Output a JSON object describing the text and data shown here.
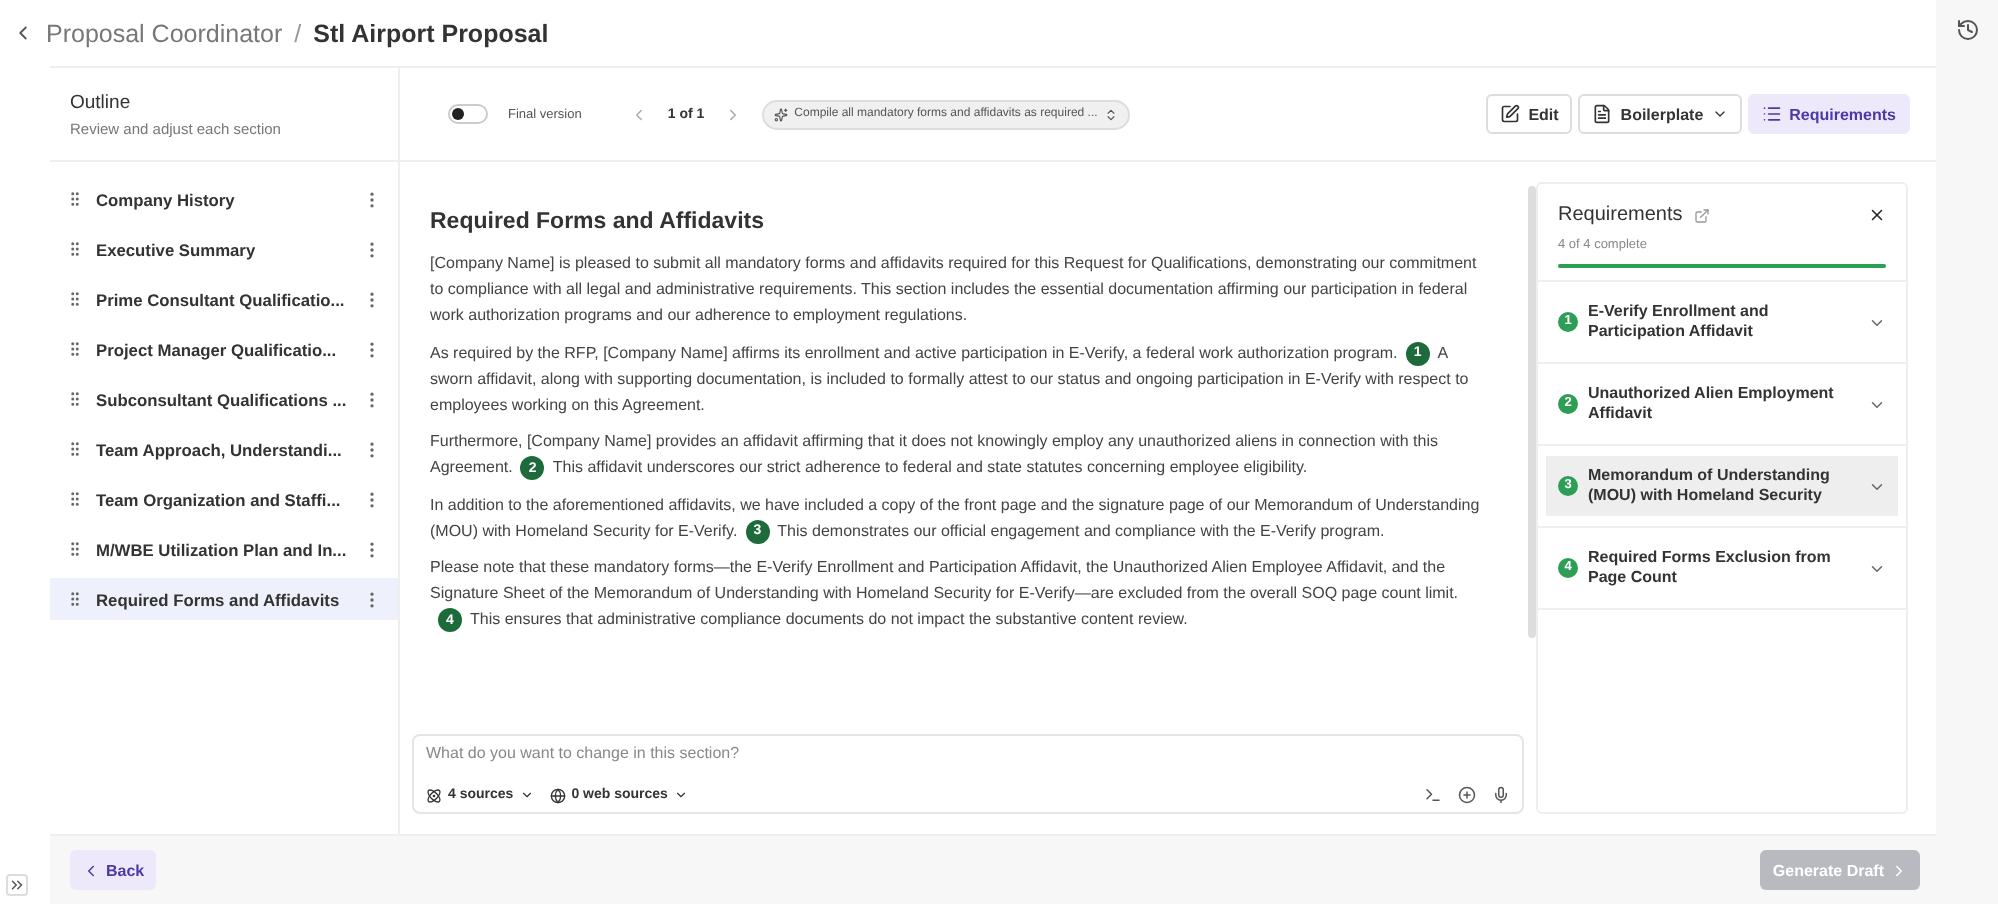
{
  "header": {
    "parent": "Proposal Coordinator",
    "separator": "/",
    "title": "Stl Airport Proposal"
  },
  "outline": {
    "title": "Outline",
    "subtitle": "Review and adjust each section",
    "items": [
      {
        "label": "Company History",
        "selected": false
      },
      {
        "label": "Executive Summary",
        "selected": false
      },
      {
        "label": "Prime Consultant Qualificatio...",
        "selected": false
      },
      {
        "label": "Project Manager Qualificatio...",
        "selected": false
      },
      {
        "label": "Subconsultant Qualifications ...",
        "selected": false
      },
      {
        "label": "Team Approach, Understandi...",
        "selected": false
      },
      {
        "label": "Team Organization and Staffi...",
        "selected": false
      },
      {
        "label": "M/WBE Utilization Plan and In...",
        "selected": false
      },
      {
        "label": "Required Forms and Affidavits",
        "selected": true
      }
    ]
  },
  "toolbar": {
    "final_version": {
      "label": "Final version",
      "on": false
    },
    "pager": "1 of 1",
    "prompt": "Compile all mandatory forms and affidavits as required ...",
    "buttons": [
      {
        "label": "Edit",
        "kind": "edit",
        "selected": false
      },
      {
        "label": "Boilerplate",
        "kind": "dropdown",
        "selected": false
      },
      {
        "label": "Requirements",
        "kind": "list",
        "selected": true
      }
    ]
  },
  "document": {
    "heading": "Required Forms and Affidavits",
    "paragraphs": [
      [
        {
          "kind": "text",
          "text": "[Company Name] is pleased to submit all mandatory forms and affidavits required for this Request for Qualifications, demonstrating our commitment to compliance with all legal and administrative requirements. This section includes the essential documentation affirming our participation in federal work authorization programs and our adherence to employment regulations."
        }
      ],
      [
        {
          "kind": "text",
          "text": "As required by the RFP, [Company Name] affirms its enrollment and active participation in E-Verify, a federal work authorization program."
        },
        {
          "kind": "citation",
          "text": "1"
        },
        {
          "kind": "text",
          "text": "A sworn affidavit, along with supporting documentation, is included to formally attest to our status and ongoing participation in E-Verify with respect to employees working on this Agreement."
        }
      ],
      [
        {
          "kind": "text",
          "text": "Furthermore, [Company Name] provides an affidavit affirming that it does not knowingly employ any unauthorized aliens in connection with this Agreement."
        },
        {
          "kind": "citation",
          "text": "2"
        },
        {
          "kind": "text",
          "text": "This affidavit underscores our strict adherence to federal and state statutes concerning employee eligibility."
        }
      ],
      [
        {
          "kind": "text",
          "text": "In addition to the aforementioned affidavits, we have included a copy of the front page and the signature page of our Memorandum of Understanding (MOU) with Homeland Security for E-Verify."
        },
        {
          "kind": "citation",
          "text": "3"
        },
        {
          "kind": "text",
          "text": "This demonstrates our official engagement and compliance with the E-Verify program."
        }
      ],
      [
        {
          "kind": "text",
          "text": "Please note that these mandatory forms—the E-Verify Enrollment and Participation Affidavit, the Unauthorized Alien Employee Affidavit, and the Signature Sheet of the Memorandum of Understanding with Homeland Security for E-Verify—are excluded from the overall SOQ page count limit."
        },
        {
          "kind": "citation",
          "text": "4"
        },
        {
          "kind": "text",
          "text": "This ensures that administrative compliance documents do not impact the substantive content review."
        }
      ]
    ]
  },
  "chat": {
    "placeholder": "What do you want to change in this section?",
    "sources": "4 sources",
    "web_sources": "0 web sources"
  },
  "requirements": {
    "title": "Requirements",
    "progress_text": "4 of 4 complete",
    "level": 1,
    "items": [
      {
        "number": "1",
        "label": "E-Verify Enrollment and Participation Affidavit",
        "selected": false
      },
      {
        "number": "2",
        "label": "Unauthorized Alien Employment Affidavit",
        "selected": false
      },
      {
        "number": "3",
        "label": "Memorandum of Understanding (MOU) with Homeland Security",
        "selected": true
      },
      {
        "number": "4",
        "label": "Required Forms Exclusion from Page Count",
        "selected": false
      }
    ]
  },
  "footer": {
    "back": "Back",
    "generate": {
      "label": "Generate Draft",
      "disabled": true
    }
  }
}
